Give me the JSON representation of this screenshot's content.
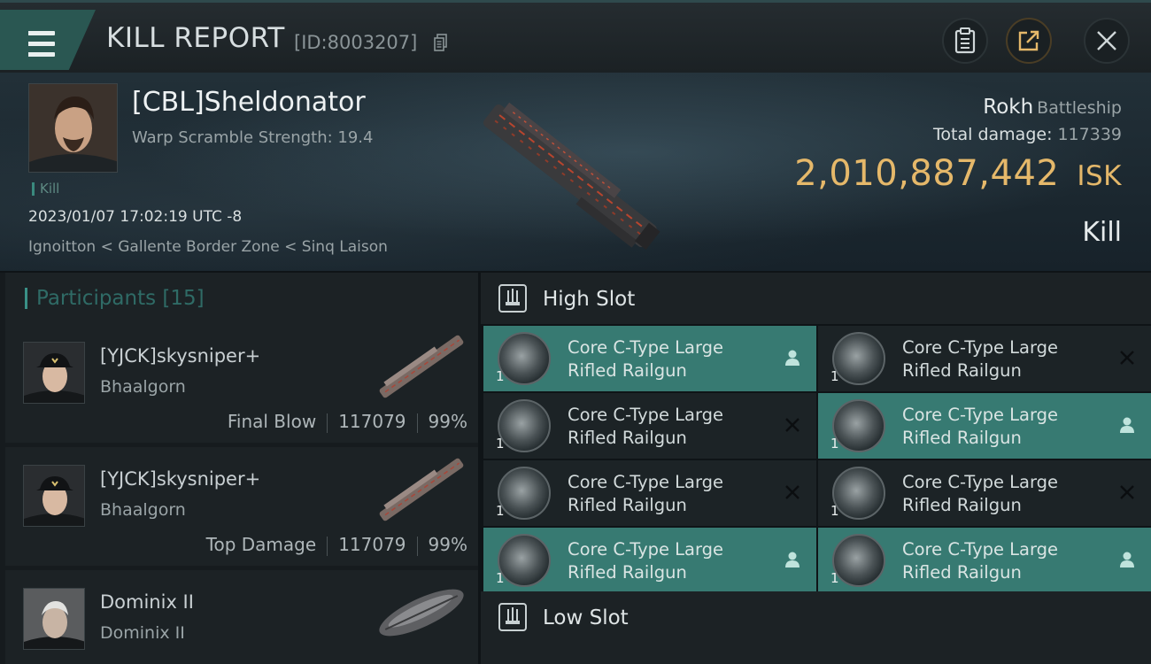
{
  "header": {
    "title": "KILL REPORT",
    "report_id": "[ID:8003207]"
  },
  "victim": {
    "name": "[CBL]Sheldonator",
    "warp_scramble": "Warp Scramble Strength: 19.4",
    "kill_tag": "Kill",
    "datetime": "2023/01/07 17:02:19 UTC -8",
    "location": "Ignoitton < Gallente Border Zone < Sinq Laison",
    "ship": "Rokh",
    "ship_class": "Battleship",
    "total_damage_label": "Total damage:",
    "total_damage": "117339",
    "isk_value": "2,010,887,442",
    "isk_unit": "ISK",
    "result": "Kill"
  },
  "participants": {
    "title": "Participants",
    "count": "[15]",
    "rows": [
      {
        "name": "[YJCK]skysniper+",
        "ship": "Bhaalgorn",
        "role": "Final Blow",
        "damage": "117079",
        "percent": "99%"
      },
      {
        "name": "[YJCK]skysniper+",
        "ship": "Bhaalgorn",
        "role": "Top Damage",
        "damage": "117079",
        "percent": "99%"
      },
      {
        "name": "Dominix II",
        "ship": "Dominix II",
        "role": "",
        "damage": "",
        "percent": ""
      }
    ]
  },
  "slots": {
    "high_label": "High Slot",
    "low_label": "Low Slot",
    "modules": [
      {
        "line1": "Core C-Type Large",
        "line2": "Rifled Railgun",
        "qty": "1",
        "status": "dropped"
      },
      {
        "line1": "Core C-Type Large",
        "line2": "Rifled Railgun",
        "qty": "1",
        "status": "destroyed"
      },
      {
        "line1": "Core C-Type Large",
        "line2": "Rifled Railgun",
        "qty": "1",
        "status": "destroyed"
      },
      {
        "line1": "Core C-Type Large",
        "line2": "Rifled Railgun",
        "qty": "1",
        "status": "dropped"
      },
      {
        "line1": "Core C-Type Large",
        "line2": "Rifled Railgun",
        "qty": "1",
        "status": "destroyed"
      },
      {
        "line1": "Core C-Type Large",
        "line2": "Rifled Railgun",
        "qty": "1",
        "status": "destroyed"
      },
      {
        "line1": "Core C-Type Large",
        "line2": "Rifled Railgun",
        "qty": "1",
        "status": "dropped"
      },
      {
        "line1": "Core C-Type Large",
        "line2": "Rifled Railgun",
        "qty": "1",
        "status": "dropped"
      }
    ]
  },
  "colors": {
    "accent_teal": "#377a72",
    "isk_gold": "#e5b86a"
  }
}
